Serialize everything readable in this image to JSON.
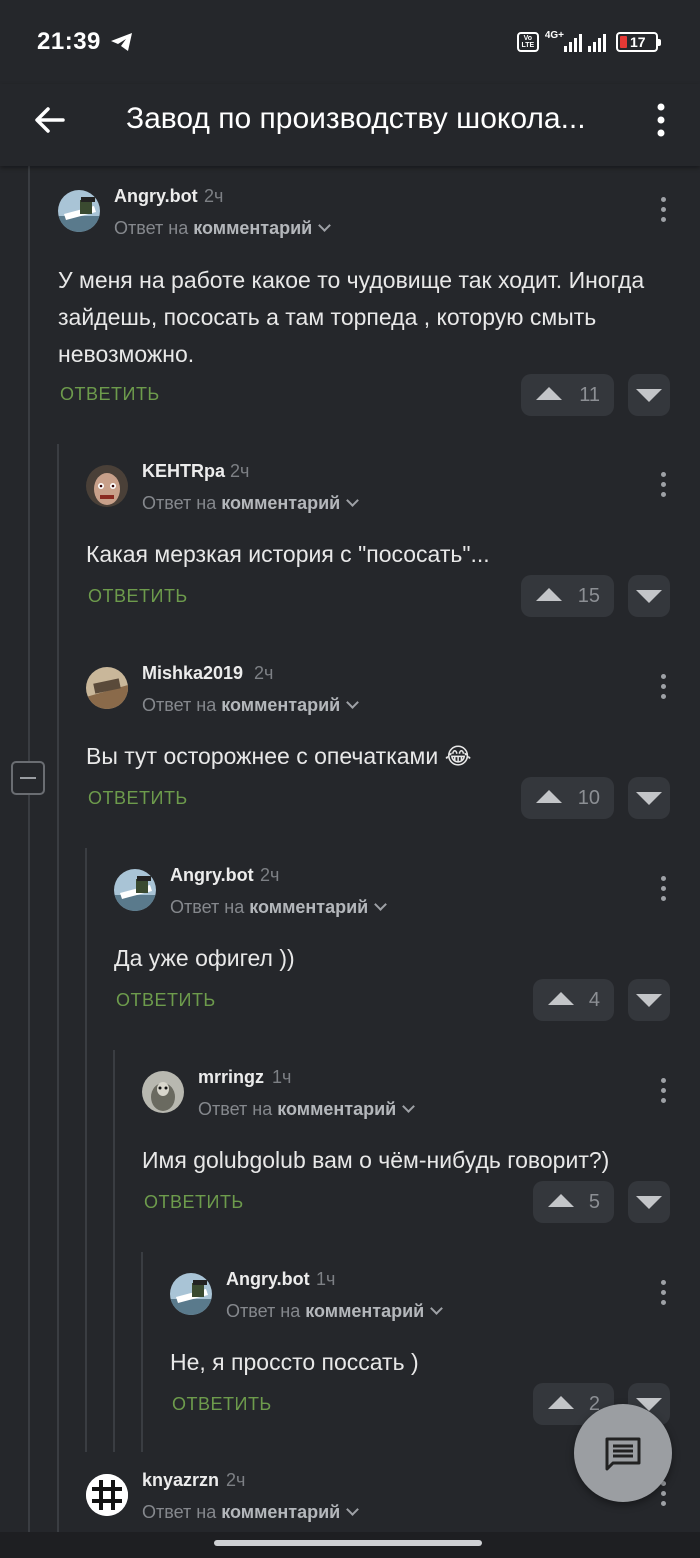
{
  "status": {
    "time": "21:39",
    "volte": "Vo LTE",
    "network": "4G+",
    "battery": "17"
  },
  "appbar": {
    "title": "Завод по производству шокола..."
  },
  "labels": {
    "reply_to_prefix": "Ответ на",
    "reply_to_target": "комментарий",
    "reply_action": "ОТВЕТИТЬ"
  },
  "comments": [
    {
      "author": "Angry.bot",
      "time": "2ч",
      "text": "У меня на работе какое то чудовище так ходит. Иногда зайдешь, пососать а там торпеда , которую смыть невозможно.",
      "votes": "11"
    },
    {
      "author": "KEHTRpa",
      "time": "2ч",
      "text": "Какая мерзкая история с \"пососать\"...",
      "votes": "15"
    },
    {
      "author": "Mishka2019",
      "time": "2ч",
      "text": "Вы тут осторожнее с опечатками 😂",
      "votes": "10"
    },
    {
      "author": "Angry.bot",
      "time": "2ч",
      "text": "Да уже офигел ))",
      "votes": "4"
    },
    {
      "author": "mrringz",
      "time": "1ч",
      "text": "Имя golubgolub вам о чём-нибудь говорит?)",
      "votes": "5"
    },
    {
      "author": "Angry.bot",
      "time": "1ч",
      "text": "Не, я проссто поссать )",
      "votes": "2"
    },
    {
      "author": "knyazrzn",
      "time": "2ч",
      "text": "",
      "votes": ""
    }
  ],
  "colors": {
    "background": "#25272b",
    "reply_action": "#6d9b4c",
    "battery_low": "#e53935"
  }
}
